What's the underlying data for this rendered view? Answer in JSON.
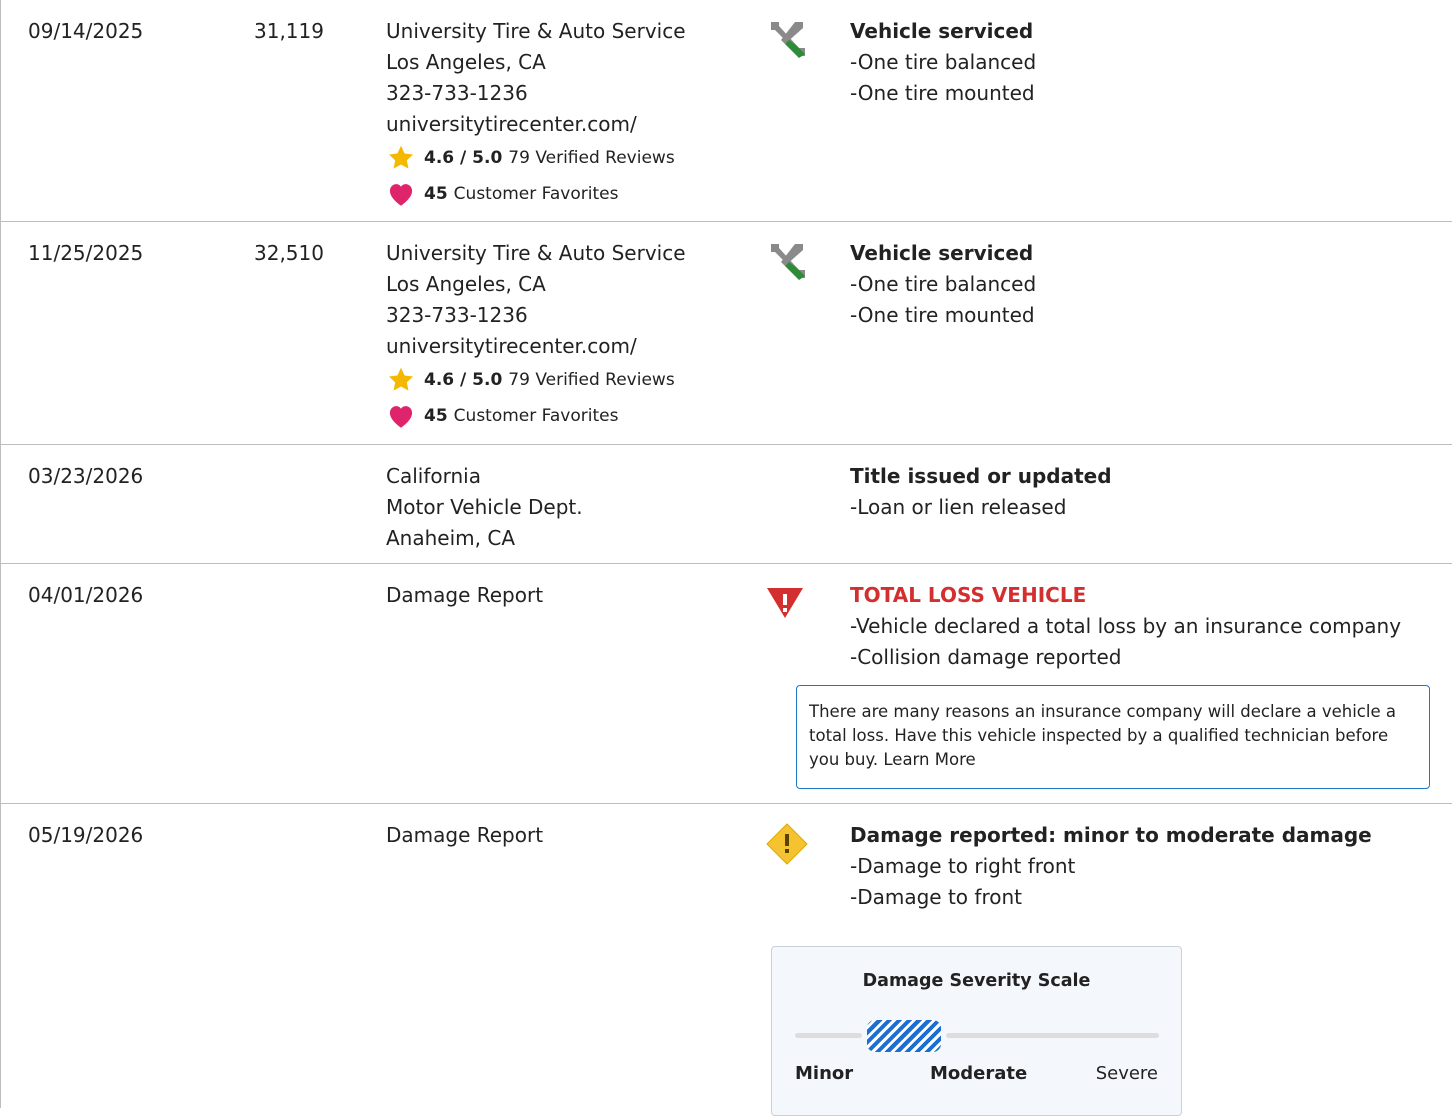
{
  "records": [
    {
      "date": "09/14/2025",
      "odometer": "31,119",
      "source": [
        "University Tire & Auto Service",
        "Los Angeles, CA",
        "323-733-1236",
        "universitytirecenter.com/"
      ],
      "rating": {
        "score": "4.6 / 5.0",
        "reviews": "79 Verified Reviews"
      },
      "favorites": {
        "count": "45",
        "label": "Customer Favorites"
      },
      "icon": "wrench-screwdriver-icon",
      "title": "Vehicle serviced",
      "details": [
        "-One tire balanced",
        "-One tire mounted"
      ]
    },
    {
      "date": "11/25/2025",
      "odometer": "32,510",
      "source": [
        "University Tire & Auto Service",
        "Los Angeles, CA",
        "323-733-1236",
        "universitytirecenter.com/"
      ],
      "rating": {
        "score": "4.6 / 5.0",
        "reviews": "79 Verified Reviews"
      },
      "favorites": {
        "count": "45",
        "label": "Customer Favorites"
      },
      "icon": "wrench-screwdriver-icon",
      "title": "Vehicle serviced",
      "details": [
        "-One tire balanced",
        "-One tire mounted"
      ]
    },
    {
      "date": "03/23/2026",
      "odometer": "",
      "source": [
        "California",
        "Motor Vehicle Dept.",
        "Anaheim, CA"
      ],
      "title": "Title issued or updated",
      "details": [
        "-Loan or lien released"
      ]
    },
    {
      "date": "04/01/2026",
      "odometer": "",
      "source": [
        "Damage Report"
      ],
      "icon": "alert-triangle-icon",
      "title": "TOTAL LOSS VEHICLE",
      "details": [
        "-Vehicle declared a total loss by an insurance company",
        "-Collision damage reported"
      ],
      "note": "There are many reasons an insurance company will declare a vehicle a total loss. Have this vehicle inspected by a qualified technician before you buy. Learn More"
    },
    {
      "date": "05/19/2026",
      "odometer": "",
      "source": [
        "Damage Report"
      ],
      "icon": "alert-diamond-icon",
      "title": "Damage reported: minor to moderate damage",
      "details": [
        "-Damage to right front",
        "-Damage to front"
      ],
      "severity": {
        "title": "Damage Severity Scale",
        "labels": [
          "Minor",
          "Moderate",
          "Severe"
        ],
        "level": "minor-to-moderate"
      }
    }
  ],
  "colors": {
    "border": "#bdbdbd",
    "alert_red": "#d32f2f",
    "warning_yellow": "#f5c330",
    "star": "#f5b800",
    "heart": "#e0246b",
    "link_blue": "#1f77c7",
    "wrench_gray": "#8a8a8a",
    "screwdriver_green": "#2e8b3a"
  }
}
